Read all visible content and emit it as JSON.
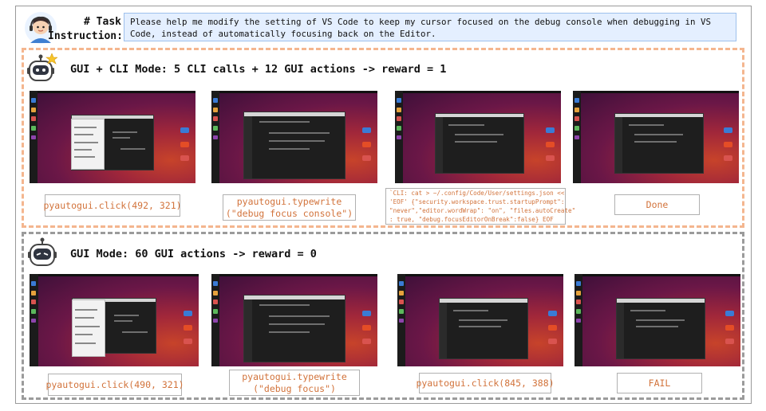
{
  "task": {
    "label_lines": [
      "# Task",
      "Instruction:"
    ],
    "instruction": "Please help me modify the setting of VS Code to keep my cursor focused on the debug console when debugging in VS Code, instead of automatically focusing back on the Editor."
  },
  "colors": {
    "mixed_border": "#f4b68f",
    "gui_border": "#9b9b9b",
    "instruction_bg": "#e4efff",
    "action_text": "#d2733b"
  },
  "sections": [
    {
      "title": "GUI + CLI Mode: 5 CLI calls + 12 GUI actions -> reward = 1",
      "icon": "robot-star-icon",
      "steps": [
        {
          "lines": [
            "pyautogui.click(492, 321)"
          ],
          "screenshot": "vscode-welcome-menu"
        },
        {
          "lines": [
            "pyautogui.typewrite",
            "(\"debug focus console\")"
          ],
          "screenshot": "vscode-settings-search"
        },
        {
          "lines": [
            "`CLI: cat > ~/.config/Code/User/settings.json <<",
            "'EOF' {\"security.workspace.trust.startupPrompt\":",
            "\"never\",\"editor.wordWrap\": \"on\", \"files.autoCreate\"",
            ": true, \"debug.focusEditorOnBreak\":false} EOF"
          ],
          "screenshot": "vscode-settings-json"
        },
        {
          "lines": [
            "Done"
          ],
          "screenshot": "vscode-settings-result"
        }
      ]
    },
    {
      "title": "GUI Mode: 60 GUI actions -> reward = 0",
      "icon": "robot-sad-icon",
      "steps": [
        {
          "lines": [
            "pyautogui.click(490, 321)"
          ],
          "screenshot": "vscode-welcome-menu"
        },
        {
          "lines": [
            "pyautogui.typewrite",
            "(\"debug focus\")"
          ],
          "screenshot": "vscode-settings-search"
        },
        {
          "lines": [
            "pyautogui.click(845, 388)"
          ],
          "screenshot": "vscode-settings-editor"
        },
        {
          "lines": [
            "FAIL"
          ],
          "screenshot": "vscode-settings-unchanged"
        }
      ]
    }
  ]
}
